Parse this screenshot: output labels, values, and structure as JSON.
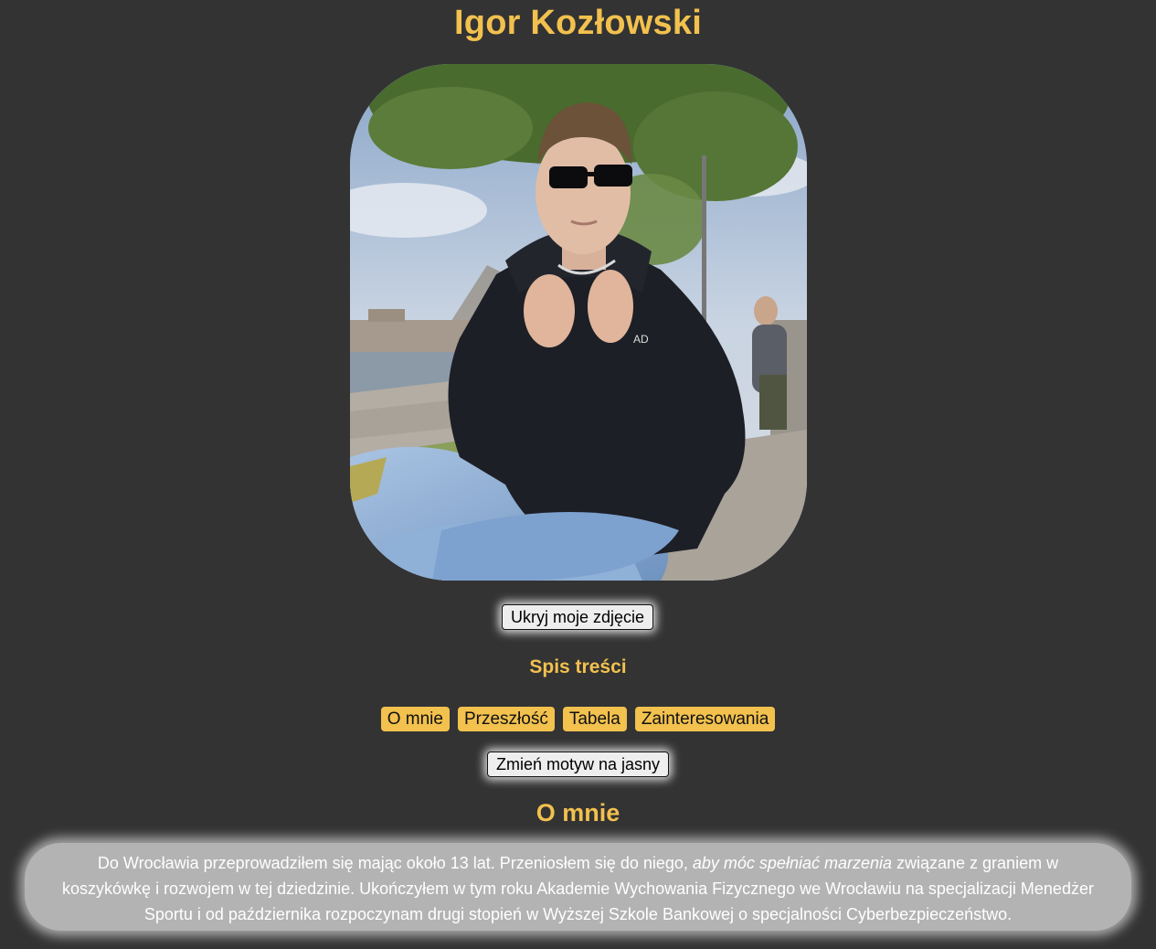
{
  "page": {
    "title": "Igor Kozłowski"
  },
  "photo": {
    "alt": "Igor Kozłowski"
  },
  "buttons": {
    "hide_photo": "Ukryj moje zdjęcie",
    "theme_toggle": "Zmień motyw na jasny"
  },
  "toc": {
    "title": "Spis treści",
    "items": [
      {
        "label": "O mnie"
      },
      {
        "label": "Przeszłość"
      },
      {
        "label": "Tabela"
      },
      {
        "label": "Zainteresowania"
      }
    ]
  },
  "about": {
    "heading": "O mnie",
    "text_before": "Do Wrocławia przeprowadziłem się mając około 13 lat. Przeniosłem się do niego, ",
    "text_emphasis": "aby móc spełniać marzenia",
    "text_after": " związane z graniem w koszykówkę i rozwojem w tej dziedzinie. Ukończyłem w tym roku Akademie Wychowania Fizycznego we Wrocławiu na specjalizacji Menedżer Sportu i od października rozpoczynam drugi stopień w Wyższej Szkole Bankowej o specjalności Cyberbezpieczeństwo."
  },
  "colors": {
    "background": "#333333",
    "accent": "#f2c14e",
    "about_box": "#b3b3b3"
  }
}
